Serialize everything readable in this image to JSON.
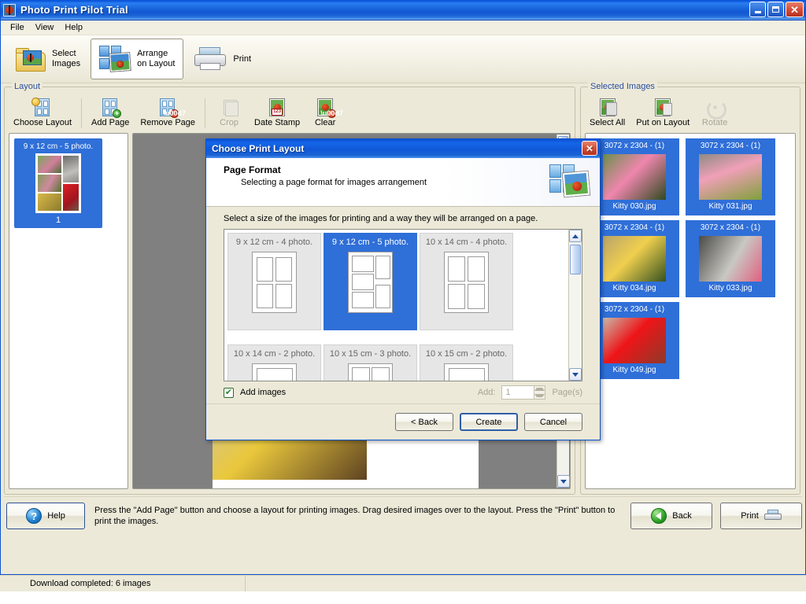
{
  "window": {
    "title": "Photo Print Pilot Trial",
    "icon": "ladybug-icon",
    "minimize_label": "Minimize",
    "maximize_label": "Maximize",
    "close_label": "✕"
  },
  "menu": {
    "items": [
      "File",
      "View",
      "Help"
    ]
  },
  "toolbar": {
    "buttons": [
      {
        "label": "Select\nImages",
        "icon": "folder-images-icon",
        "active": false
      },
      {
        "label": "Arrange\non Layout",
        "icon": "layout-grid-icon",
        "active": true
      },
      {
        "label": "Print",
        "icon": "printer-icon",
        "active": false
      }
    ]
  },
  "layout_group": {
    "title": "Layout",
    "buttons": [
      {
        "label": "Choose Layout",
        "icon": "choose-layout-icon",
        "disabled": false
      },
      {
        "label": "Add Page",
        "icon": "add-page-icon",
        "disabled": false
      },
      {
        "label": "Remove Page",
        "icon": "remove-page-icon",
        "disabled": false
      },
      {
        "label": "Crop",
        "icon": "crop-icon",
        "disabled": true
      },
      {
        "label": "Date Stamp",
        "icon": "date-stamp-icon",
        "disabled": false
      },
      {
        "label": "Clear",
        "icon": "clear-icon",
        "disabled": false
      }
    ]
  },
  "selected_images_group": {
    "title": "Selected Images",
    "buttons": [
      {
        "label": "Select All",
        "icon": "select-all-icon",
        "disabled": false
      },
      {
        "label": "Put on Layout",
        "icon": "put-on-layout-icon",
        "disabled": false
      },
      {
        "label": "Rotate",
        "icon": "rotate-icon",
        "disabled": true
      }
    ]
  },
  "pages_panel": {
    "pages": [
      {
        "caption": "9 x 12 cm - 5 photo.",
        "number": "1",
        "selected": true
      }
    ]
  },
  "images_panel": {
    "items": [
      {
        "dimensions": "3072 x 2304 - (1)",
        "name": "Kitty 030.jpg",
        "color_a": "#d6829c",
        "color_b": "#4c7a3a"
      },
      {
        "dimensions": "3072 x 2304 - (1)",
        "name": "Kitty 031.jpg",
        "color_a": "#e0a0b4",
        "color_b": "#6e8f3c"
      },
      {
        "dimensions": "3072 x 2304 - (1)",
        "name": "Kitty 034.jpg",
        "color_a": "#e8c24a",
        "color_b": "#4a6f2c"
      },
      {
        "dimensions": "3072 x 2304 - (1)",
        "name": "Kitty 033.jpg",
        "color_a": "#b9b9b4",
        "color_b": "#d8496a"
      },
      {
        "dimensions": "3072 x 2304 - (1)",
        "name": "Kitty 049.jpg",
        "color_a": "#e01e22",
        "color_b": "#b4162a"
      }
    ]
  },
  "dialog": {
    "title": "Choose Print Layout",
    "close_label": "✕",
    "header_title": "Page Format",
    "header_subtitle": "Selecting a page format for images arrangement",
    "instruction": "Select a size of the images for printing and a way they will be arranged on a page.",
    "layouts": [
      {
        "label": "9 x 12 cm - 4 photo.",
        "selected": false,
        "cells": 4,
        "pattern": "2x2"
      },
      {
        "label": "9 x 12 cm - 5 photo.",
        "selected": true,
        "cells": 5,
        "pattern": "5mix"
      },
      {
        "label": "10 x 14 cm - 4 photo.",
        "selected": false,
        "cells": 4,
        "pattern": "2x2"
      },
      {
        "label": "10 x 14 cm - 2 photo.",
        "selected": false,
        "cells": 2,
        "pattern": "1x2"
      },
      {
        "label": "10 x 15 cm - 3 photo.",
        "selected": false,
        "cells": 3,
        "pattern": "3mix"
      },
      {
        "label": "10 x 15 cm - 2 photo.",
        "selected": false,
        "cells": 2,
        "pattern": "1x2"
      }
    ],
    "add_images_label": "Add images",
    "add_images_checked": true,
    "check_glyph": "✔",
    "add_label": "Add:",
    "add_value": "1",
    "pages_label": "Page(s)",
    "buttons": {
      "back": "< Back",
      "create": "Create",
      "cancel": "Cancel"
    }
  },
  "bottom": {
    "help_label": "Help",
    "help_glyph": "?",
    "hint": "Press the \"Add Page\" button and choose a layout for printing images. Drag desired images over to the layout. Press the \"Print\" button to print the images.",
    "back_label": "Back",
    "print_label": "Print"
  },
  "statusbar": {
    "left": "Download completed:   6 images",
    "right": ""
  },
  "colors": {
    "selection_blue": "#2f6fd8",
    "titlebar_blue": "#0a4fd0",
    "chrome_beige": "#ece9d8",
    "canvas_gray": "#808080"
  }
}
